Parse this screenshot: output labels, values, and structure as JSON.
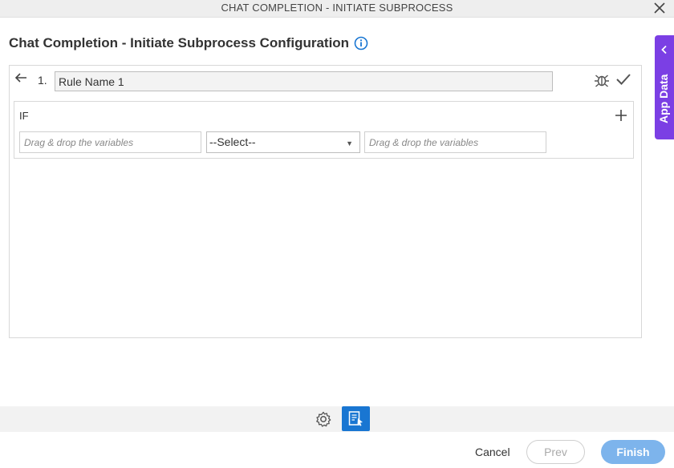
{
  "window": {
    "title": "CHAT COMPLETION - INITIATE SUBPROCESS"
  },
  "page": {
    "heading": "Chat Completion - Initiate Subprocess Configuration"
  },
  "rule": {
    "number": "1.",
    "name_value": "Rule Name 1",
    "condition": {
      "if_label": "IF",
      "left_placeholder": "Drag & drop the variables",
      "operator_selected": "--Select--",
      "right_placeholder": "Drag & drop the variables"
    }
  },
  "side_panel": {
    "label": "App Data"
  },
  "footer": {
    "cancel_label": "Cancel",
    "prev_label": "Prev",
    "finish_label": "Finish"
  },
  "colors": {
    "accent_purple": "#7b3fe4",
    "accent_blue": "#1976d2",
    "finish_button": "#7db4ec"
  },
  "icons": [
    "close-icon",
    "info-icon",
    "back-arrow-icon",
    "bug-icon",
    "check-icon",
    "plus-icon",
    "dropdown-arrow-icon",
    "chevron-left-icon",
    "gear-icon",
    "document-icon"
  ]
}
